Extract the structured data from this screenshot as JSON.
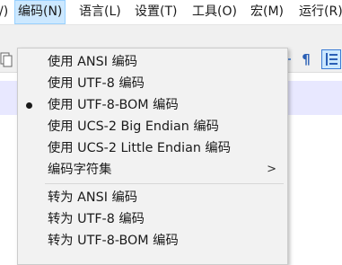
{
  "menubar": {
    "items": [
      {
        "label": "/)"
      },
      {
        "label": "编码(N)"
      },
      {
        "label": "语言(L)"
      },
      {
        "label": "设置(T)"
      },
      {
        "label": "工具(O)"
      },
      {
        "label": "宏(M)"
      },
      {
        "label": "运行(R)"
      }
    ]
  },
  "toolbar": {
    "pilcrow_icon": "pilcrow-icon",
    "indent_guide_icon": "indent-guide-icon",
    "colors": {
      "accent": "#cce8ff",
      "band": "#e8e8ff"
    }
  },
  "encoding_menu": {
    "items": [
      {
        "label": "使用 ANSI 编码",
        "checked": false
      },
      {
        "label": "使用 UTF-8 编码",
        "checked": false
      },
      {
        "label": "使用 UTF-8-BOM 编码",
        "checked": true
      },
      {
        "label": "使用 UCS-2 Big Endian 编码",
        "checked": false
      },
      {
        "label": "使用 UCS-2 Little Endian 编码",
        "checked": false
      },
      {
        "label": "编码字符集",
        "submenu": true
      },
      {
        "label": "转为 ANSI 编码"
      },
      {
        "label": "转为 UTF-8 编码"
      },
      {
        "label": "转为 UTF-8-BOM 编码"
      }
    ],
    "submenu_arrow": ">"
  }
}
